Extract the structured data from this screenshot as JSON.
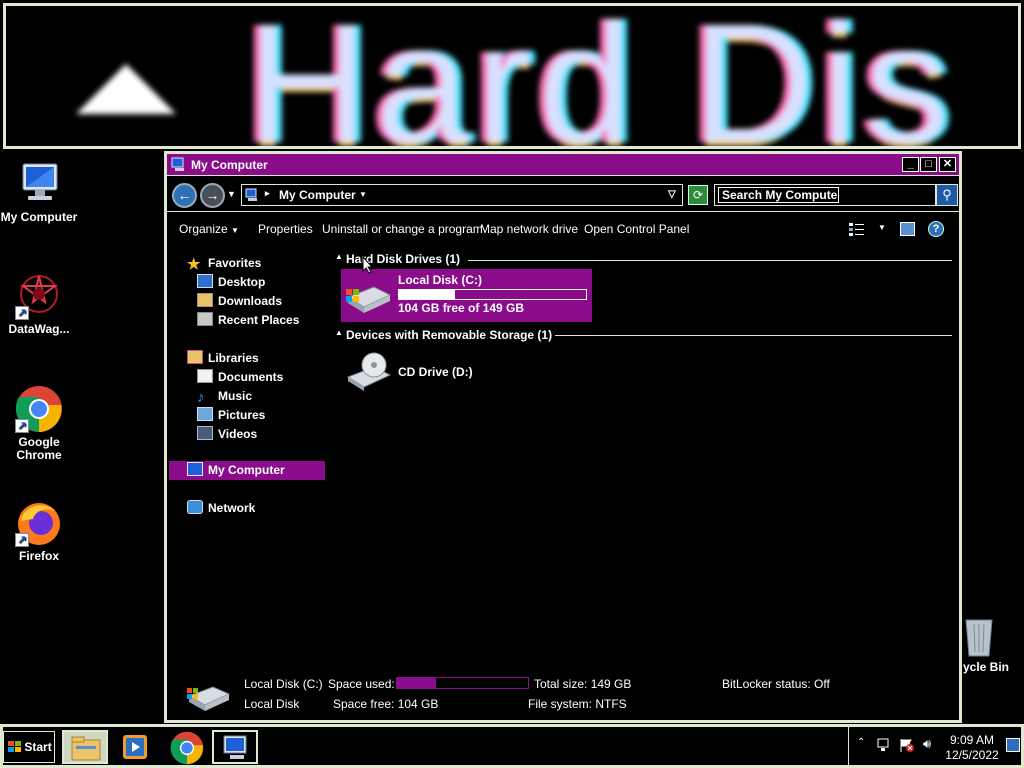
{
  "magnifier": {
    "text": "Hard Dis"
  },
  "desktop": {
    "icons": [
      {
        "label": "My Computer",
        "icon": "my-computer-icon"
      },
      {
        "label": "DataWag...",
        "icon": "datawag-icon"
      },
      {
        "label": "Google Chrome",
        "icon": "chrome-icon"
      },
      {
        "label": "Firefox",
        "icon": "firefox-icon"
      },
      {
        "label": "ycle Bin",
        "icon": "recycle-bin-icon"
      }
    ]
  },
  "window": {
    "title": "My Computer",
    "address": "My Computer",
    "search_placeholder": "Search My Computer",
    "toolbar": {
      "organize": "Organize",
      "properties": "Properties",
      "uninstall": "Uninstall or change a program",
      "map_drive": "Map network drive",
      "control_panel": "Open Control Panel"
    },
    "nav": {
      "favorites": "Favorites",
      "desktop": "Desktop",
      "downloads": "Downloads",
      "recent": "Recent Places",
      "libraries": "Libraries",
      "documents": "Documents",
      "music": "Music",
      "pictures": "Pictures",
      "videos": "Videos",
      "computer": "My Computer",
      "network": "Network"
    },
    "groups": {
      "hdd": "Hard Disk Drives (1)",
      "removable": "Devices with Removable Storage (1)"
    },
    "drives": {
      "c": {
        "name": "Local Disk (C:)",
        "free_text": "104 GB free of 149 GB",
        "used_fraction": 0.3
      },
      "d": {
        "name": "CD Drive (D:)"
      }
    },
    "details": {
      "name": "Local Disk (C:)",
      "type": "Local Disk",
      "space_used_label": "Space used:",
      "space_used_fraction": 0.3,
      "space_free": "Space free: 104 GB",
      "total_size": "Total size: 149 GB",
      "file_system": "File system: NTFS",
      "bitlocker": "BitLocker status: Off"
    }
  },
  "taskbar": {
    "start": "Start",
    "time": "9:09 AM",
    "date": "12/5/2022"
  },
  "colors": {
    "accent": "#8b0c8b",
    "border": "#dfe8d0",
    "background": "#000000"
  }
}
